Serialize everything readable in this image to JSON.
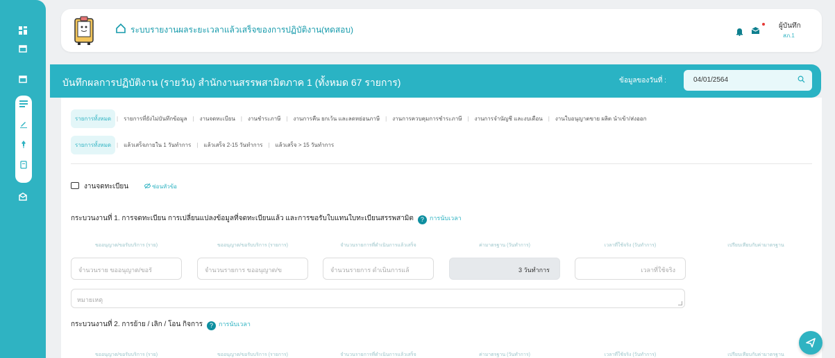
{
  "app": {
    "title": "ระบบรายงานผลระยะเวลาแล้วเสร็จของการปฏิบัติงาน(ทดสอบ)",
    "user_name": "ผู้บันทึก",
    "user_sub": "สภ.1"
  },
  "sidebar": {
    "icons": [
      "dashboard-icon",
      "calendar-icon",
      "calendar-icon",
      "list-icon",
      "edit-icon",
      "pin-icon",
      "document-icon",
      "inbox-icon"
    ]
  },
  "titlebar": {
    "title": "บันทึกผลการปฏิบัติงาน (รายวัน) สำนักงานสรรพสามิตภาค 1 (ทั้งหมด 67 รายการ)",
    "date_label": "ข้อมูลของวันที่ :",
    "date_value": "04/01/2564"
  },
  "tabs_primary": [
    "รายการทั้งหมด",
    "รายการที่ยังไม่บันทึกข้อมูล",
    "งานจดทะเบียน",
    "งานชำระภาษี",
    "งานการคืน ยกเว้น และลดหย่อนภาษี",
    "งานการควบคุมการชำระภาษี",
    "งานการจำนัญชี และงบเดือน",
    "งานใบอนุญาตขาย ผลิต นำเข้า/ส่งออก"
  ],
  "tabs_secondary": [
    "รายการทั้งหมด",
    "แล้วเสร็จภายใน 1 วันทำการ",
    "แล้วเสร็จ 2-15 วันทำการ",
    "แล้วเสร็จ > 15 วันทำการ"
  ],
  "section": {
    "title": "งานจดทะเบียน",
    "hide_label": "ซ่อนหัวข้อ"
  },
  "process1": {
    "title": "กระบวนงานที่ 1. การจดทะเบียน การเปลี่ยนแปลงข้อมูลที่จดทะเบียนแล้ว และการขอรับใบแทนใบทะเบียนสรรพสามิต",
    "help": "การนับเวลา"
  },
  "process2": {
    "title": "กระบวนงานที่ 2. การย้าย / เลิก / โอน กิจการ",
    "help": "การนับเวลา"
  },
  "columns": [
    "ขออนุญาต/ขอรับบริการ (ราย)",
    "ขออนุญาต/ขอรับบริการ (รายการ)",
    "จำนวนรายการที่ดำเนินการแล้วเสร็จ",
    "ค่ามาตรฐาน (วันทำการ)",
    "เวลาที่ใช้จริง (วันทำการ)",
    "เปรียบเทียบกับค่ามาตรฐาน"
  ],
  "inputs": {
    "persons_placeholder": "จำนวนราย ขออนุญาต/ขอรั",
    "items_placeholder": "จำนวนรายการ ขออนุญาต/ข",
    "done_placeholder": "จำนวนรายการ ดำเนินการแล้",
    "standard_value": "3 วันทำการ",
    "actual_placeholder": "เวลาที่ใช้จริง",
    "remark_placeholder": "หมายเหตุ"
  },
  "colors": {
    "primary": "#2fb3c2",
    "titlebar": "#2ab3c4",
    "dark_teal": "#0e8fa0"
  }
}
